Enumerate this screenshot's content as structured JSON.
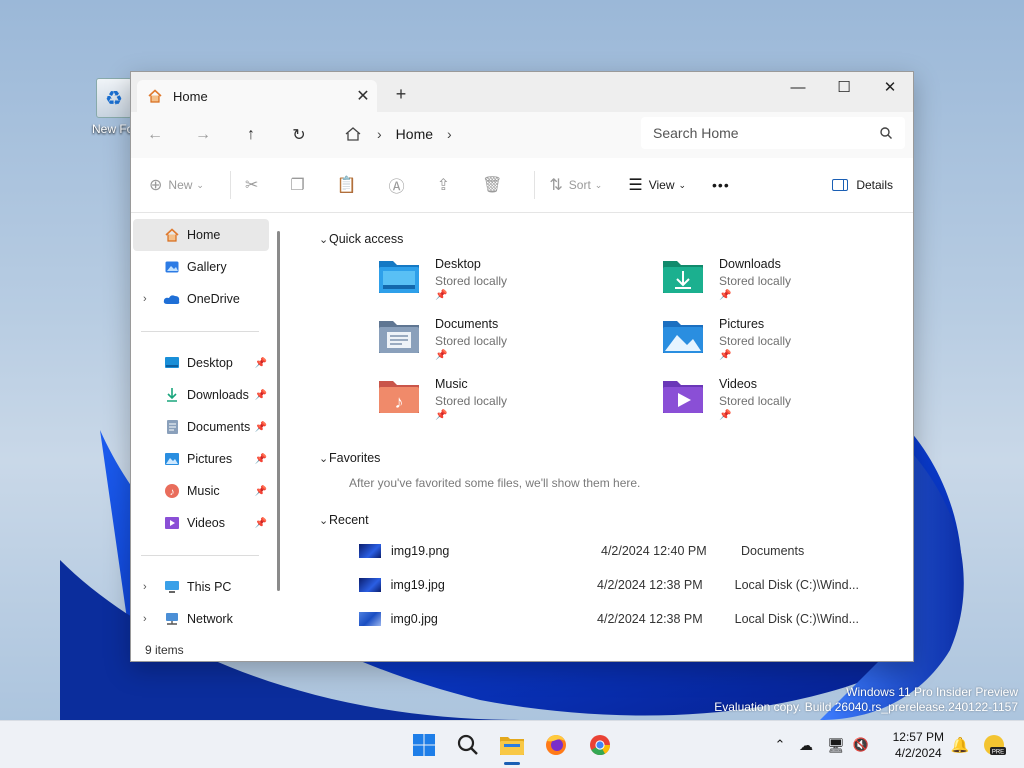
{
  "desktop": {
    "icon_label": "New Fol",
    "watermark_line1": "Windows 11 Pro Insider Preview",
    "watermark_line2": "Evaluation copy. Build 26040.rs_prerelease.240122-1157"
  },
  "window": {
    "tab_title": "Home",
    "new_tab": "+",
    "controls": {
      "minimize": "—",
      "maximize": "☐",
      "close": "✕"
    }
  },
  "address": {
    "crumb": "Home",
    "search_placeholder": "Search Home"
  },
  "toolbar": {
    "new": "New",
    "sort": "Sort",
    "view": "View",
    "more": "•••",
    "details": "Details"
  },
  "sidebar": {
    "top": [
      {
        "label": "Home"
      },
      {
        "label": "Gallery"
      },
      {
        "label": "OneDrive"
      }
    ],
    "pinned": [
      {
        "label": "Desktop"
      },
      {
        "label": "Downloads"
      },
      {
        "label": "Documents"
      },
      {
        "label": "Pictures"
      },
      {
        "label": "Music"
      },
      {
        "label": "Videos"
      }
    ],
    "bottom": [
      {
        "label": "This PC"
      },
      {
        "label": "Network"
      }
    ]
  },
  "content": {
    "quick_access_title": "Quick access",
    "quick_access": [
      {
        "name": "Desktop",
        "status": "Stored locally",
        "color": "#1a8fd8"
      },
      {
        "name": "Downloads",
        "status": "Stored locally",
        "color": "#1bb08f"
      },
      {
        "name": "Documents",
        "status": "Stored locally",
        "color": "#7f93ad"
      },
      {
        "name": "Pictures",
        "status": "Stored locally",
        "color": "#2a8ee0"
      },
      {
        "name": "Music",
        "status": "Stored locally",
        "color": "#e96d5c"
      },
      {
        "name": "Videos",
        "status": "Stored locally",
        "color": "#8a4fd6"
      }
    ],
    "favorites_title": "Favorites",
    "favorites_message": "After you've favorited some files, we'll show them here.",
    "recent_title": "Recent",
    "recent": [
      {
        "name": "img19.png",
        "date": "4/2/2024 12:40 PM",
        "location": "Documents"
      },
      {
        "name": "img19.jpg",
        "date": "4/2/2024 12:38 PM",
        "location": "Local Disk (C:)\\Wind..."
      },
      {
        "name": "img0.jpg",
        "date": "4/2/2024 12:38 PM",
        "location": "Local Disk (C:)\\Wind..."
      }
    ]
  },
  "status": {
    "items": "9 items"
  },
  "taskbar": {
    "time": "12:57 PM",
    "date": "4/2/2024"
  }
}
